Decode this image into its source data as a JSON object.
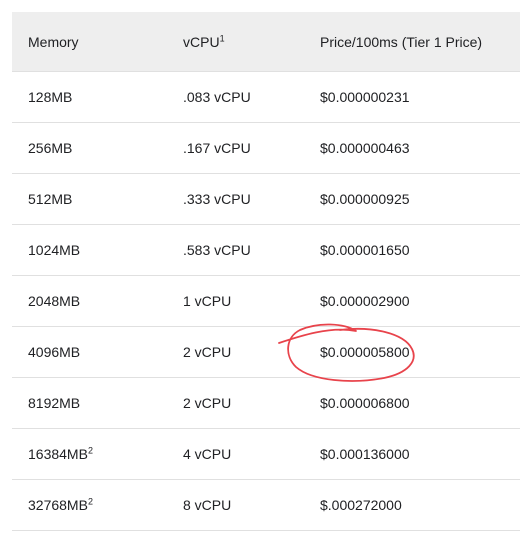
{
  "table": {
    "headers": {
      "memory": "Memory",
      "vcpu": "vCPU",
      "vcpu_sup": "1",
      "price": "Price/100ms (Tier 1 Price)"
    },
    "rows": [
      {
        "memory": "128MB",
        "memory_sup": "",
        "vcpu": ".083 vCPU",
        "price": "$0.000000231"
      },
      {
        "memory": "256MB",
        "memory_sup": "",
        "vcpu": ".167 vCPU",
        "price": "$0.000000463"
      },
      {
        "memory": "512MB",
        "memory_sup": "",
        "vcpu": ".333 vCPU",
        "price": "$0.000000925"
      },
      {
        "memory": "1024MB",
        "memory_sup": "",
        "vcpu": ".583 vCPU",
        "price": "$0.000001650"
      },
      {
        "memory": "2048MB",
        "memory_sup": "",
        "vcpu": "1 vCPU",
        "price": "$0.000002900"
      },
      {
        "memory": "4096MB",
        "memory_sup": "",
        "vcpu": "2 vCPU",
        "price": "$0.000005800"
      },
      {
        "memory": "8192MB",
        "memory_sup": "",
        "vcpu": "2 vCPU",
        "price": "$0.000006800"
      },
      {
        "memory": "16384MB",
        "memory_sup": "2",
        "vcpu": "4 vCPU",
        "price": "$0.000136000"
      },
      {
        "memory": "32768MB",
        "memory_sup": "2",
        "vcpu": "8 vCPU",
        "price": "$.000272000"
      }
    ]
  },
  "annotation": {
    "type": "hand-drawn-circle",
    "target_row": 5,
    "target_column": "price",
    "color": "#e8434b"
  }
}
